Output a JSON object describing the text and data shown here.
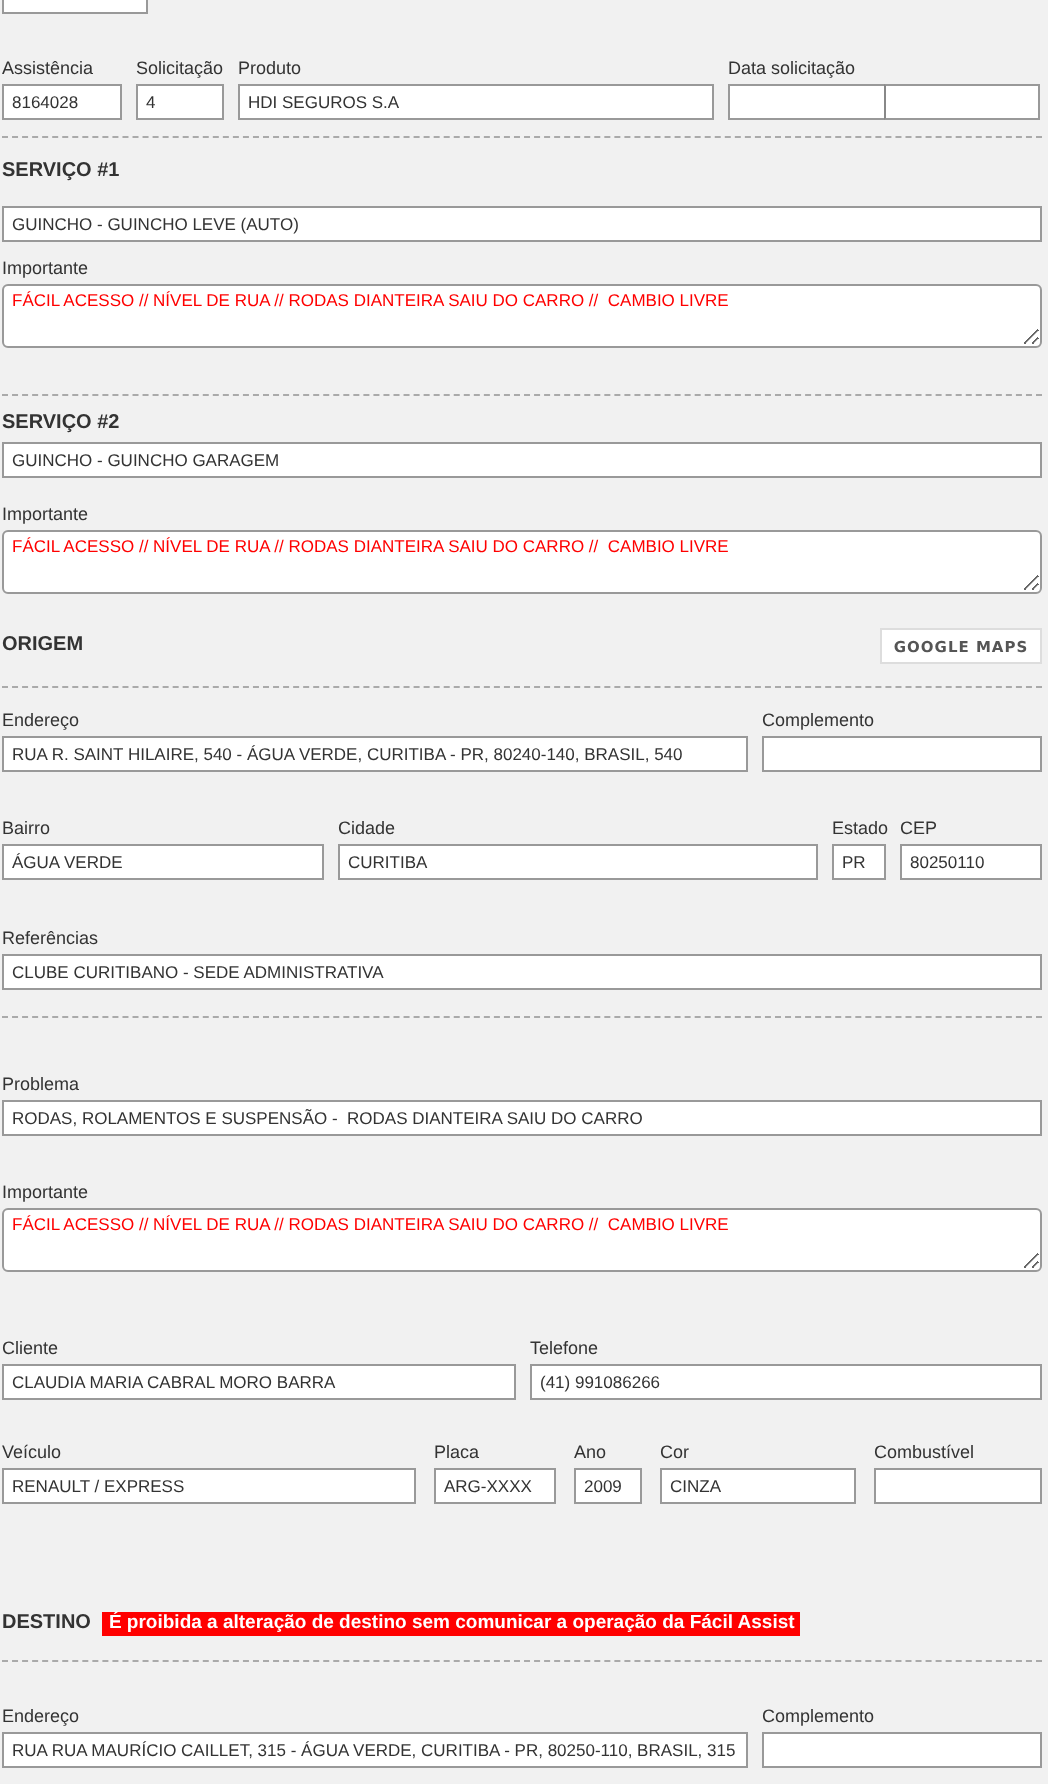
{
  "request": [
    {
      "label": "Assistência",
      "value": "8164028"
    },
    {
      "label": "Solicitação",
      "value": "4"
    },
    {
      "label": "Produto",
      "value": "HDI SEGUROS S.A"
    },
    {
      "label": "Data solicitação"
    }
  ],
  "services": [
    {
      "title": "SERVIÇO #1",
      "service": "GUINCHO - GUINCHO LEVE (AUTO)",
      "note_label": "Importante",
      "note": "FÁCIL ACESSO // NÍVEL DE RUA // RODAS DIANTEIRA SAIU DO CARRO //  CAMBIO LIVRE"
    },
    {
      "title": "SERVIÇO #2",
      "service": "GUINCHO - GUINCHO GARAGEM",
      "note_label": "Importante",
      "note": "FÁCIL ACESSO // NÍVEL DE RUA // RODAS DIANTEIRA SAIU DO CARRO //  CAMBIO LIVRE"
    }
  ],
  "origin": {
    "title": "ORIGEM",
    "maps_button": "GOOGLE MAPS",
    "address": {
      "label": "Endereço",
      "value": "RUA R. SAINT HILAIRE, 540 - ÁGUA VERDE, CURITIBA - PR, 80240-140, BRASIL, 540"
    },
    "complement": {
      "label": "Complemento"
    },
    "neighborhood": {
      "label": "Bairro",
      "value": "ÁGUA VERDE"
    },
    "city": {
      "label": "Cidade",
      "value": "CURITIBA"
    },
    "state": {
      "label": "Estado",
      "value": "PR"
    },
    "zip": {
      "label": "CEP",
      "value": "80250110"
    },
    "references": {
      "label": "Referências",
      "value": "CLUBE CURITIBANO - SEDE ADMINISTRATIVA"
    }
  },
  "problem": {
    "problem": {
      "label": "Problema",
      "value": "RODAS, ROLAMENTOS E SUSPENSÃO -  RODAS DIANTEIRA SAIU DO CARRO"
    },
    "note": {
      "label": "Importante",
      "value": "FÁCIL ACESSO // NÍVEL DE RUA // RODAS DIANTEIRA SAIU DO CARRO //  CAMBIO LIVRE"
    }
  },
  "customer": {
    "client": {
      "label": "Cliente",
      "value": "CLAUDIA MARIA CABRAL MORO BARRA"
    },
    "phone": {
      "label": "Telefone",
      "value": "(41) 991086266"
    }
  },
  "vehicle": [
    {
      "label": "Veículo",
      "value": "RENAULT / EXPRESS"
    },
    {
      "label": "Placa",
      "value": "ARG-XXXX"
    },
    {
      "label": "Ano",
      "value": "2009"
    },
    {
      "label": "Cor",
      "value": "CINZA"
    },
    {
      "label": "Combustível"
    }
  ],
  "destination": {
    "title": "DESTINO",
    "warning": "É proibida a alteração de destino sem comunicar a operação da Fácil Assist",
    "address": {
      "label": "Endereço",
      "value": "RUA RUA MAURÍCIO CAILLET, 315 - ÁGUA VERDE, CURITIBA - PR, 80250-110, BRASIL, 315"
    },
    "complement": {
      "label": "Complemento"
    }
  }
}
